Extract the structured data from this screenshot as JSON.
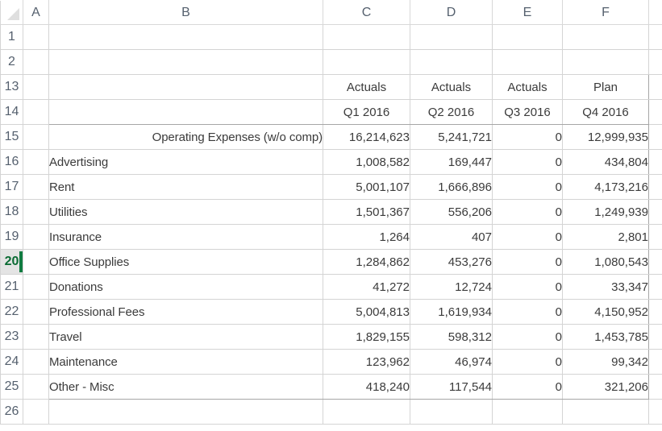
{
  "app": {
    "type": "spreadsheet",
    "select_all_corner": "select-all-triangle"
  },
  "colors": {
    "label_blue": "#1F6FA8",
    "header_blue": "#1F6391",
    "number_gray": "#3B3B3B",
    "selection_green": "#107C41",
    "grid_line": "#D4D4D4",
    "heavy_border": "#A6A6A6",
    "row_header_text": "#55606E",
    "selected_row_bg": "#E4E4E4"
  },
  "columns": {
    "headers": [
      "A",
      "B",
      "C",
      "D",
      "E",
      "F"
    ]
  },
  "rows": {
    "numbers": [
      "1",
      "2",
      "13",
      "14",
      "15",
      "16",
      "17",
      "18",
      "19",
      "20",
      "21",
      "22",
      "23",
      "24",
      "25",
      "26"
    ],
    "selected": "20"
  },
  "sheet": {
    "blank_rows_top": [
      "1",
      "2"
    ],
    "header_band": {
      "row_13": {
        "row": "13",
        "b": "",
        "c": "Actuals",
        "d": "Actuals",
        "e": "Actuals",
        "f": "Plan"
      },
      "row_14": {
        "row": "14",
        "b": "",
        "c": "Q1 2016",
        "d": "Q2 2016",
        "e": "Q3 2016",
        "f": "Q4 2016"
      }
    },
    "data_rows": [
      {
        "row": "15",
        "label": "Operating Expenses (w/o comp)",
        "kind": "total",
        "c": "16,214,623",
        "d": "5,241,721",
        "e": "0",
        "f": "12,999,935"
      },
      {
        "row": "16",
        "label": "Advertising",
        "kind": "item",
        "c": "1,008,582",
        "d": "169,447",
        "e": "0",
        "f": "434,804"
      },
      {
        "row": "17",
        "label": "Rent",
        "kind": "item",
        "c": "5,001,107",
        "d": "1,666,896",
        "e": "0",
        "f": "4,173,216"
      },
      {
        "row": "18",
        "label": "Utilities",
        "kind": "item",
        "c": "1,501,367",
        "d": "556,206",
        "e": "0",
        "f": "1,249,939"
      },
      {
        "row": "19",
        "label": "Insurance",
        "kind": "item",
        "c": "1,264",
        "d": "407",
        "e": "0",
        "f": "2,801"
      },
      {
        "row": "20",
        "label": "Office Supplies",
        "kind": "item",
        "c": "1,284,862",
        "d": "453,276",
        "e": "0",
        "f": "1,080,543"
      },
      {
        "row": "21",
        "label": "Donations",
        "kind": "item",
        "c": "41,272",
        "d": "12,724",
        "e": "0",
        "f": "33,347"
      },
      {
        "row": "22",
        "label": "Professional Fees",
        "kind": "item",
        "c": "5,004,813",
        "d": "1,619,934",
        "e": "0",
        "f": "4,150,952"
      },
      {
        "row": "23",
        "label": "Travel",
        "kind": "item",
        "c": "1,829,155",
        "d": "598,312",
        "e": "0",
        "f": "1,453,785"
      },
      {
        "row": "24",
        "label": "Maintenance",
        "kind": "item",
        "c": "123,962",
        "d": "46,974",
        "e": "0",
        "f": "99,342"
      },
      {
        "row": "25",
        "label": "Other - Misc",
        "kind": "item",
        "c": "418,240",
        "d": "117,544",
        "e": "0",
        "f": "321,206"
      }
    ],
    "blank_rows_bottom": [
      "26"
    ]
  }
}
